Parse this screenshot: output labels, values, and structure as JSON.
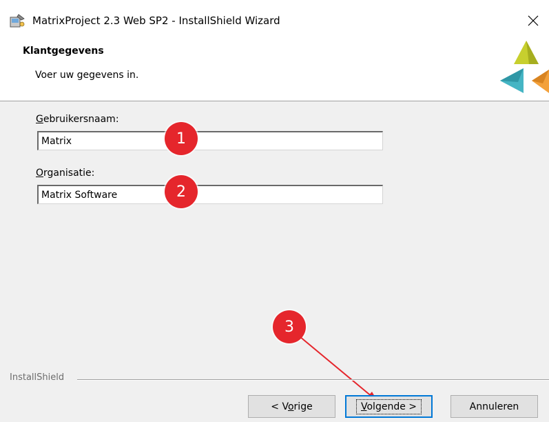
{
  "window": {
    "title": "MatrixProject 2.3 Web SP2 - InstallShield Wizard"
  },
  "header": {
    "title": "Klantgegevens",
    "subtitle": "Voer uw gegevens in."
  },
  "form": {
    "username": {
      "label_accel": "G",
      "label_rest": "ebruikersnaam:",
      "value": "Matrix"
    },
    "organization": {
      "label_accel": "O",
      "label_rest": "rganisatie:",
      "value": "Matrix Software"
    }
  },
  "annotations": {
    "badge_1": "1",
    "badge_2": "2",
    "badge_3": "3",
    "color": "#e5262c"
  },
  "footer": {
    "brand": "InstallShield"
  },
  "buttons": {
    "back": {
      "pre": "< V",
      "accel": "o",
      "post": "rige"
    },
    "next": {
      "pre": "",
      "accel": "V",
      "post": "olgende >"
    },
    "cancel": "Annuleren"
  }
}
